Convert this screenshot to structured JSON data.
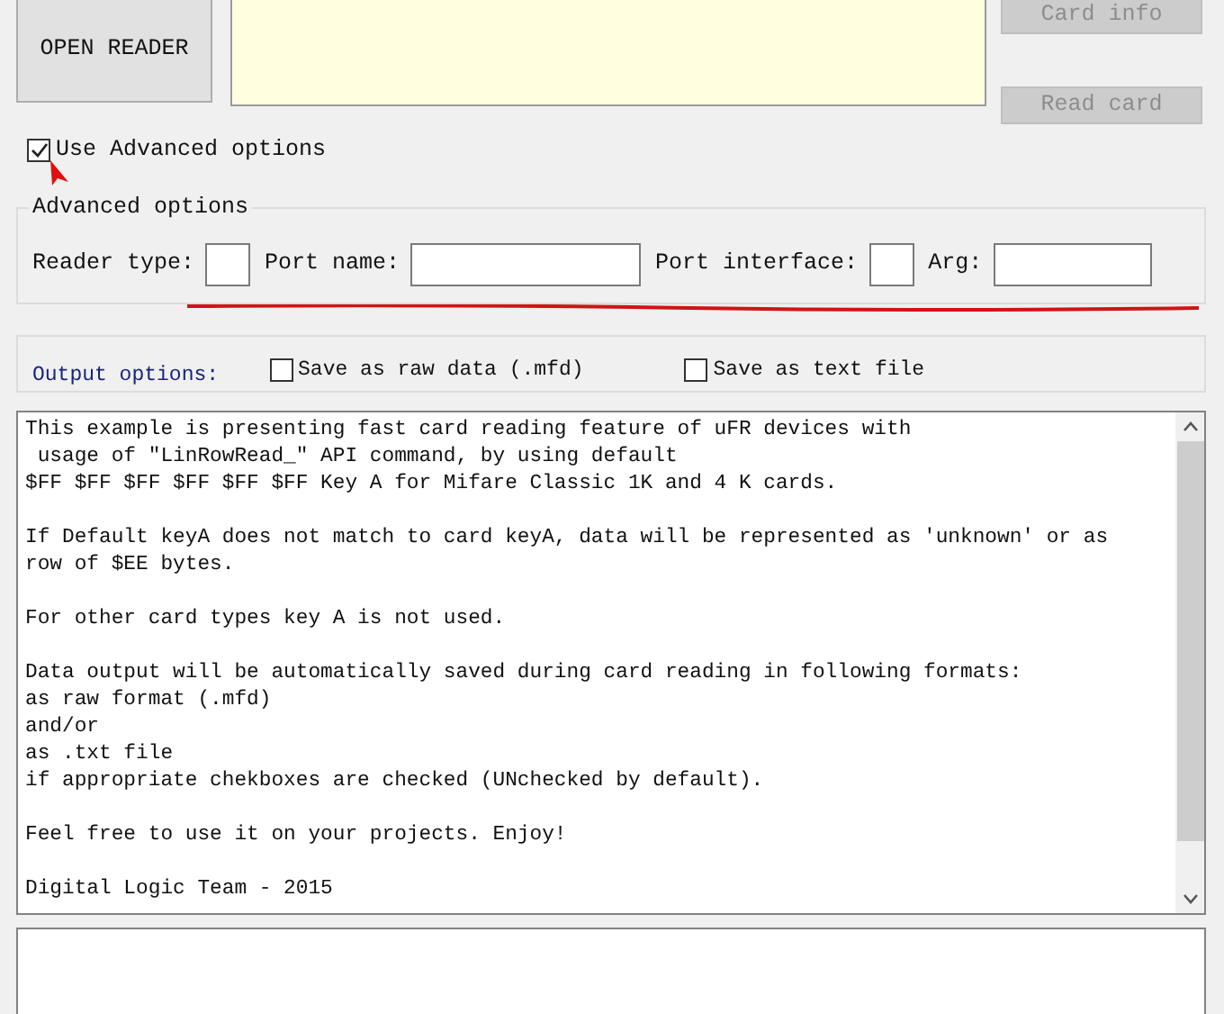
{
  "buttons": {
    "open_reader": "OPEN READER",
    "card_info": {
      "label": "Card info",
      "disabled": true
    },
    "read_card": {
      "label": "Read card",
      "disabled": true
    }
  },
  "use_advanced": {
    "label": "Use Advanced options",
    "checked": true
  },
  "advanced_options": {
    "title": "Advanced options",
    "fields": [
      {
        "label": "Reader type:"
      },
      {
        "label": "Port name:"
      },
      {
        "label": "Port interface:"
      },
      {
        "label": "Arg:"
      }
    ]
  },
  "output_options": {
    "title": "Output options:",
    "checkboxes": [
      {
        "label": "Save as raw data (.mfd)",
        "checked": false
      },
      {
        "label": "Save as text file",
        "checked": false
      }
    ]
  },
  "output_text": "This example is presenting fast card reading feature of uFR devices with\n usage of \"LinRowRead_\" API command, by using default\n$FF $FF $FF $FF $FF $FF Key A for Mifare Classic 1K and 4 K cards.\n\nIf Default keyA does not match to card keyA, data will be represented as 'unknown' or as\nrow of $EE bytes.\n\nFor other card types key A is not used.\n\nData output will be automatically saved during card reading in following formats:\nas raw format (.mfd)\nand/or\nas .txt file\nif appropriate chekboxes are checked (UNchecked by default).\n\nFeel free to use it on your projects. Enjoy!\n\nDigital Logic Team - 2015"
}
